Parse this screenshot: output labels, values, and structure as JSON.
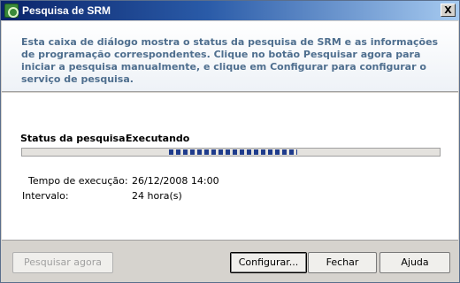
{
  "window": {
    "title": "Pesquisa de SRM",
    "close_label": "X"
  },
  "header": {
    "description": "Esta caixa de diálogo mostra o status da pesquisa de SRM e as informações de programação correspondentes. Clique no botão Pesquisar agora para iniciar a pesquisa manualmente, e clique em Configurar para configurar o serviço de pesquisa."
  },
  "status": {
    "label": "Status da pesquisa:",
    "value": "Executando"
  },
  "progress": {
    "state": "marquee",
    "fill_color": "#1f3c8c"
  },
  "details": {
    "runtime_label": "Tempo de execução:",
    "runtime_value": "26/12/2008 14:00",
    "interval_label": "Intervalo:",
    "interval_value": "24 hora(s)"
  },
  "buttons": {
    "search_now": "Pesquisar agora",
    "configure": "Configurar...",
    "close": "Fechar",
    "help": "Ajuda"
  }
}
